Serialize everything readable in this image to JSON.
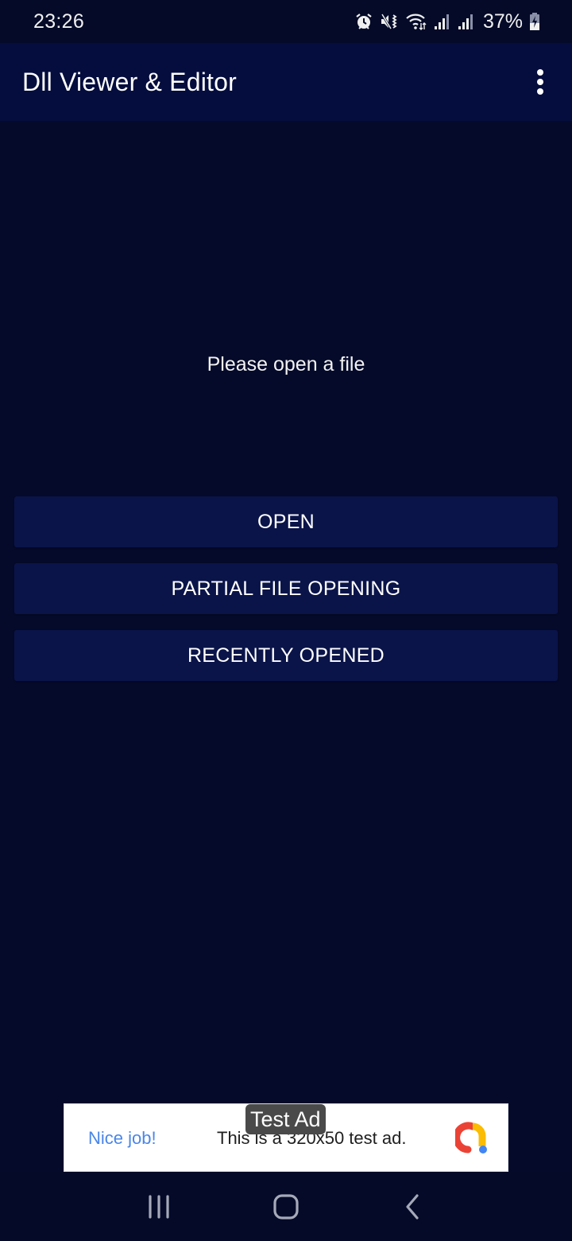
{
  "status_bar": {
    "time": "23:26",
    "icons": [
      "alarm-icon",
      "vibrate-icon",
      "wifi-icon",
      "signal-icon",
      "signal-icon"
    ],
    "battery_percent": "37%",
    "battery_charging": true
  },
  "app_bar": {
    "title": "Dll Viewer & Editor",
    "menu_icon": "more-vert-icon"
  },
  "main": {
    "empty_message": "Please open a file",
    "buttons": [
      {
        "label": "OPEN"
      },
      {
        "label": "PARTIAL FILE OPENING"
      },
      {
        "label": "RECENTLY OPENED"
      }
    ]
  },
  "ad": {
    "label": "Test Ad",
    "cta": "Nice job!",
    "text": "This is a 320x50 test ad.",
    "colors": {
      "cta": "#4a86e8",
      "logo_red": "#ea4335",
      "logo_yellow": "#fbbc04",
      "logo_blue": "#4285f4"
    }
  },
  "nav_bar": {
    "buttons": [
      {
        "name": "recent-apps",
        "icon": "recents-icon"
      },
      {
        "name": "home",
        "icon": "home-icon"
      },
      {
        "name": "back",
        "icon": "back-icon"
      }
    ]
  },
  "colors": {
    "background": "#050a2a",
    "app_bar": "#040d3d",
    "button": "#0a1449"
  }
}
